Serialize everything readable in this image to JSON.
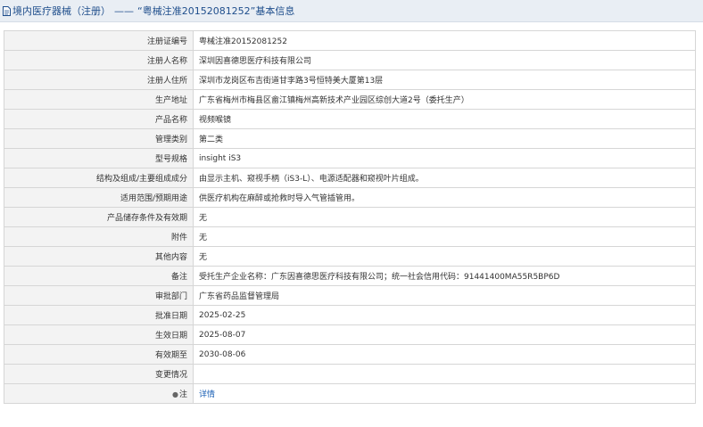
{
  "header": {
    "title": "境内医疗器械（注册）",
    "separator": "——",
    "subtitle": "“粤械注准20152081252”基本信息"
  },
  "rows": [
    {
      "label": "注册证编号",
      "value": "粤械注准20152081252"
    },
    {
      "label": "注册人名称",
      "value": "深圳因喜德思医疗科技有限公司"
    },
    {
      "label": "注册人住所",
      "value": "深圳市龙岗区布吉街道甘李路3号恒特美大厦第13层"
    },
    {
      "label": "生产地址",
      "value": "广东省梅州市梅县区畲江镇梅州高新技术产业园区综创大道2号（委托生产）"
    },
    {
      "label": "产品名称",
      "value": "视频喉镜"
    },
    {
      "label": "管理类别",
      "value": "第二类"
    },
    {
      "label": "型号规格",
      "value": "insight iS3"
    },
    {
      "label": "结构及组成/主要组成成分",
      "value": "由显示主机、窥视手柄（iS3-L）、电源适配器和窥视叶片组成。"
    },
    {
      "label": "适用范围/预期用途",
      "value": "供医疗机构在麻醉或抢救时导入气管插管用。"
    },
    {
      "label": "产品储存条件及有效期",
      "value": "无"
    },
    {
      "label": "附件",
      "value": "无"
    },
    {
      "label": "其他内容",
      "value": "无"
    },
    {
      "label": "备注",
      "value": "受托生产企业名称：广东因喜德思医疗科技有限公司；统一社会信用代码：91441400MA55R5BP6D"
    },
    {
      "label": "审批部门",
      "value": "广东省药品监督管理局"
    },
    {
      "label": "批准日期",
      "value": "2025-02-25"
    },
    {
      "label": "生效日期",
      "value": "2025-08-07"
    },
    {
      "label": "有效期至",
      "value": "2030-08-06"
    },
    {
      "label": "变更情况",
      "value": ""
    }
  ],
  "note_row": {
    "label": "注",
    "link_text": "详情"
  },
  "colors": {
    "header_bg": "#e9eef4",
    "header_text": "#1f4e8c",
    "label_bg": "#f3f3f3",
    "border": "#d6d6d6",
    "link": "#1a5fb4"
  },
  "icons": {
    "header_icon": "document-icon",
    "note_icon": "bulb-icon"
  }
}
